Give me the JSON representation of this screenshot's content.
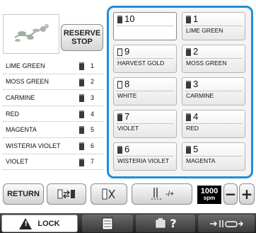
{
  "reserve_stop": {
    "label": "RESERVE\nSTOP"
  },
  "left_list": [
    {
      "name": "LIME GREEN",
      "number": "1"
    },
    {
      "name": "MOSS GREEN",
      "number": "2"
    },
    {
      "name": "CARMINE",
      "number": "3"
    },
    {
      "name": "RED",
      "number": "4"
    },
    {
      "name": "MAGENTA",
      "number": "5"
    },
    {
      "name": "WISTERIA VIOLET",
      "number": "6"
    },
    {
      "name": "VIOLET",
      "number": "7"
    }
  ],
  "grid": [
    {
      "number": "10",
      "name": "",
      "spool": "filled"
    },
    {
      "number": "1",
      "name": "LIME GREEN",
      "spool": "filled"
    },
    {
      "number": "9",
      "name": "HARVEST GOLD",
      "spool": "empty"
    },
    {
      "number": "2",
      "name": "MOSS GREEN",
      "spool": "filled"
    },
    {
      "number": "8",
      "name": "WHITE",
      "spool": "empty"
    },
    {
      "number": "3",
      "name": "CARMINE",
      "spool": "filled"
    },
    {
      "number": "7",
      "name": "VIOLET",
      "spool": "filled"
    },
    {
      "number": "4",
      "name": "RED",
      "spool": "filled"
    },
    {
      "number": "6",
      "name": "WISTERIA VIOLET",
      "spool": "filled"
    },
    {
      "number": "5",
      "name": "MAGENTA",
      "spool": "filled"
    }
  ],
  "toolbar": {
    "return_label": "RETURN",
    "speed_value": "1000",
    "speed_unit": "spm",
    "minus": "−",
    "plus": "+",
    "needle_label": "-/+"
  },
  "statusbar": {
    "lock_label": "LOCK",
    "help_symbol": "?"
  },
  "colors": {
    "accent": "#1f8fd8"
  }
}
